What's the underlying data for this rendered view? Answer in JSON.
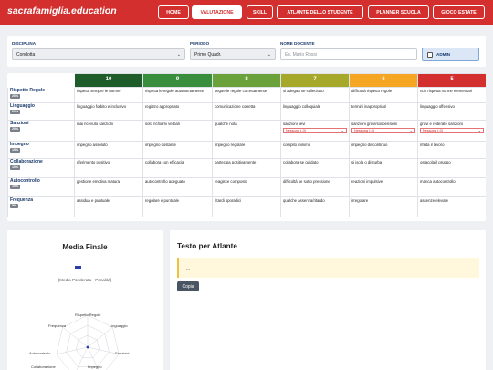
{
  "header": {
    "brand": "sacrafamiglia.education",
    "nav": [
      {
        "label": "HOME",
        "active": false
      },
      {
        "label": "VALUTAZIONE",
        "active": true
      },
      {
        "label": "SKILL",
        "active": false
      },
      {
        "label": "ATLANTE DELLO STUDENTE",
        "active": false
      },
      {
        "label": "PLANNER SCUOLA",
        "active": false
      },
      {
        "label": "GIOCO ESTATE",
        "active": false
      }
    ]
  },
  "filters": {
    "disciplina": {
      "label": "DISCIPLINA",
      "value": "Condotta"
    },
    "periodo": {
      "label": "PERIODO",
      "value": "Primo Quadr."
    },
    "docente": {
      "label": "NOME DOCENTE",
      "placeholder": "Es. Mario Rossi"
    },
    "admin": {
      "label": "ADMIN"
    }
  },
  "grades": {
    "columns": [
      {
        "label": "10",
        "color": "#1e5c2a"
      },
      {
        "label": "9",
        "color": "#388e3c"
      },
      {
        "label": "8",
        "color": "#6aa13a"
      },
      {
        "label": "7",
        "color": "#a5a829"
      },
      {
        "label": "6",
        "color": "#f5a623"
      },
      {
        "label": "5",
        "color": "#d32f2f"
      }
    ],
    "penalty_label": "Nessuna (-0)",
    "rows": [
      {
        "name": "Rispetto Regole",
        "weight": "20%",
        "cells": [
          "rispetta sempre le norme",
          "rispetta le regole autonomamente",
          "segue le regole correttamente",
          "si adegua se sollecitato",
          "difficoltà rispetto regole",
          "non rispetta norme elementari"
        ]
      },
      {
        "name": "Linguaggio",
        "weight": "20%",
        "cells": [
          "linguaggio forbito e inclusivo",
          "registro appropriato",
          "comunicazione corretta",
          "linguaggio colloquiale",
          "termini inappropriati",
          "linguaggio offensivo"
        ]
      },
      {
        "name": "Sanzioni",
        "weight": "20%",
        "cells": [
          "mai ricevuto sanzioni",
          "solo richiami verbali",
          "qualche nota",
          "sanzioni lievi",
          "sanzioni gravi/sospensioni",
          "gravi e reiterate sanzioni"
        ],
        "has_penalty": true
      },
      {
        "name": "Impegno",
        "weight": "15%",
        "cells": [
          "impegno assoluto",
          "impegno costante",
          "impegno regolare",
          "compito minimo",
          "impegno discontinuo",
          "rifiuta il lavoro"
        ]
      },
      {
        "name": "Collaborazione",
        "weight": "10%",
        "cells": [
          "riferimento positivo",
          "collabora con efficacia",
          "partecipa positivamente",
          "collabora se guidato",
          "si isola o disturba",
          "ostacola il gruppo"
        ]
      },
      {
        "name": "Autocontrollo",
        "weight": "10%",
        "cells": [
          "gestione emotiva matura",
          "autocontrollo adeguato",
          "reagisce composto",
          "difficoltà se sotto pressione",
          "reazioni impulsive",
          "manca autocontrollo"
        ]
      },
      {
        "name": "Frequenza",
        "weight": "5%",
        "cells": [
          "assidua e puntuale",
          "regolare e puntuale",
          "ritardi sporadici",
          "qualche assenza/ritardo",
          "irregolare",
          "assenze elevate"
        ]
      }
    ]
  },
  "media": {
    "title": "Media Finale",
    "subtitle": "(Media Ponderata - Penalità)",
    "radar_labels": [
      "Rispetto Regole",
      "Linguaggio",
      "Sanzioni",
      "Impegno",
      "Collaborazione",
      "Autocontrollo",
      "Frequenza"
    ]
  },
  "atlante": {
    "title": "Testo per Atlante",
    "text": "...",
    "copy_label": "Copia"
  }
}
